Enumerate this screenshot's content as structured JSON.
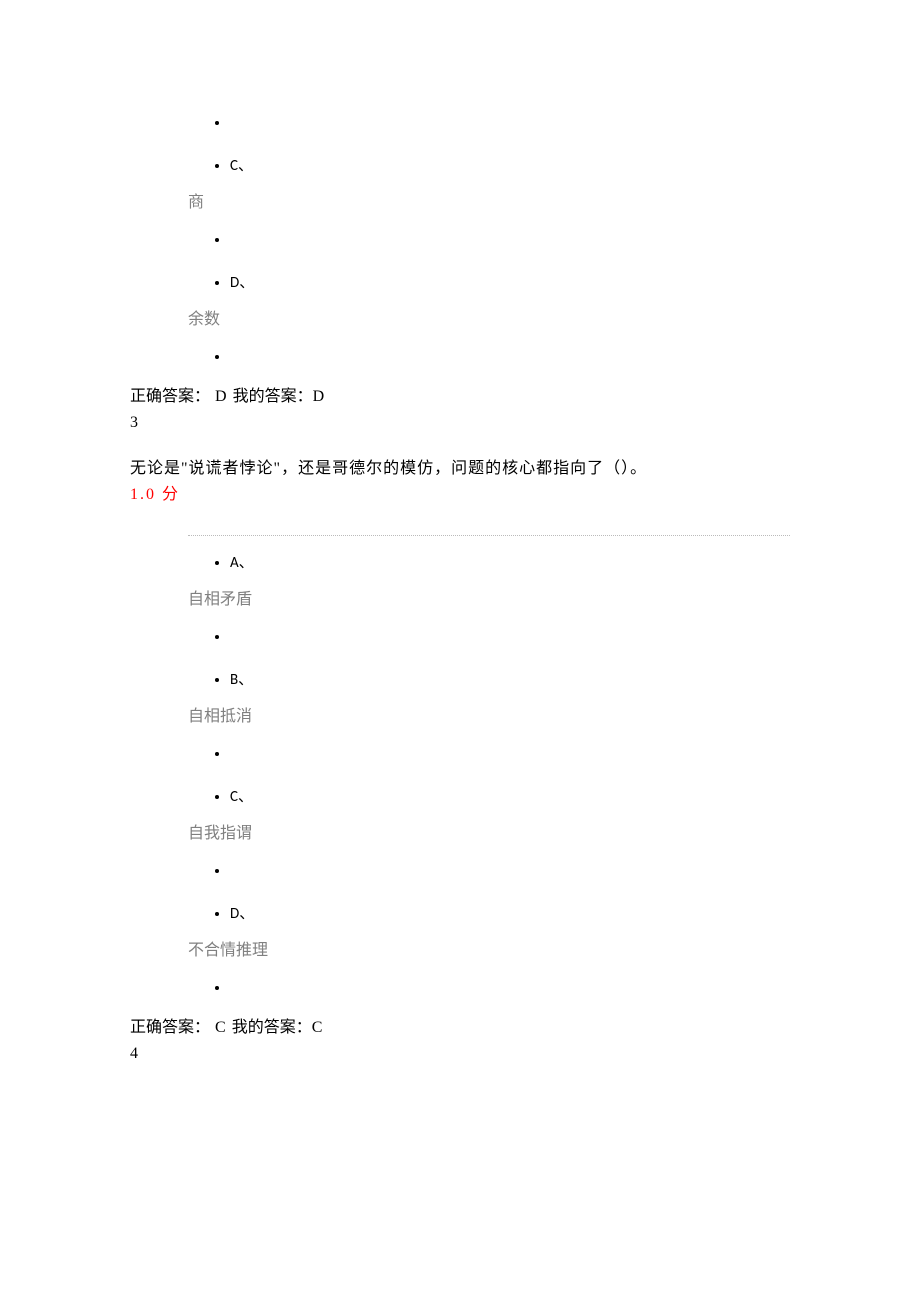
{
  "q_prev": {
    "options": [
      {
        "label": "C、",
        "text": "商"
      },
      {
        "label": "D、",
        "text": "余数"
      }
    ],
    "answer_label_correct": "正确答案：",
    "answer_correct": "D",
    "answer_label_mine": "我的答案：",
    "answer_mine": "D",
    "next_num": "3"
  },
  "q3": {
    "question": "无论是\"说谎者悖论\"，还是哥德尔的模仿，问题的核心都指向了（）。",
    "score": "1.0 分",
    "options": [
      {
        "label": "A、",
        "text": "自相矛盾"
      },
      {
        "label": "B、",
        "text": "自相抵消"
      },
      {
        "label": "C、",
        "text": "自我指谓"
      },
      {
        "label": "D、",
        "text": "不合情推理"
      }
    ],
    "answer_label_correct": "正确答案：",
    "answer_correct": "C",
    "answer_label_mine": "我的答案：",
    "answer_mine": "C",
    "next_num": "4"
  }
}
